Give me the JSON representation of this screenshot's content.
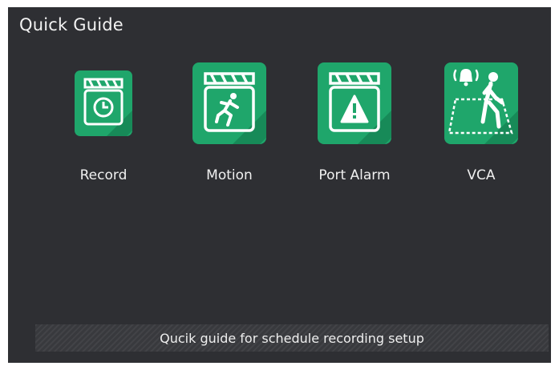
{
  "window": {
    "title": "Quick Guide"
  },
  "colors": {
    "panel_background": "#2e2f33",
    "tile_green": "#1fa66b",
    "tile_shadow": "#178a58",
    "icon_white": "#ffffff"
  },
  "menu": {
    "items": [
      {
        "label": "Record",
        "icon": "record-clapper-clock-icon"
      },
      {
        "label": "Motion",
        "icon": "motion-clapper-running-icon"
      },
      {
        "label": "Port Alarm",
        "icon": "port-alarm-clapper-warning-icon"
      },
      {
        "label": "VCA",
        "icon": "vca-person-alarm-icon"
      }
    ]
  },
  "footer": {
    "hint": "Qucik guide for schedule recording setup"
  }
}
